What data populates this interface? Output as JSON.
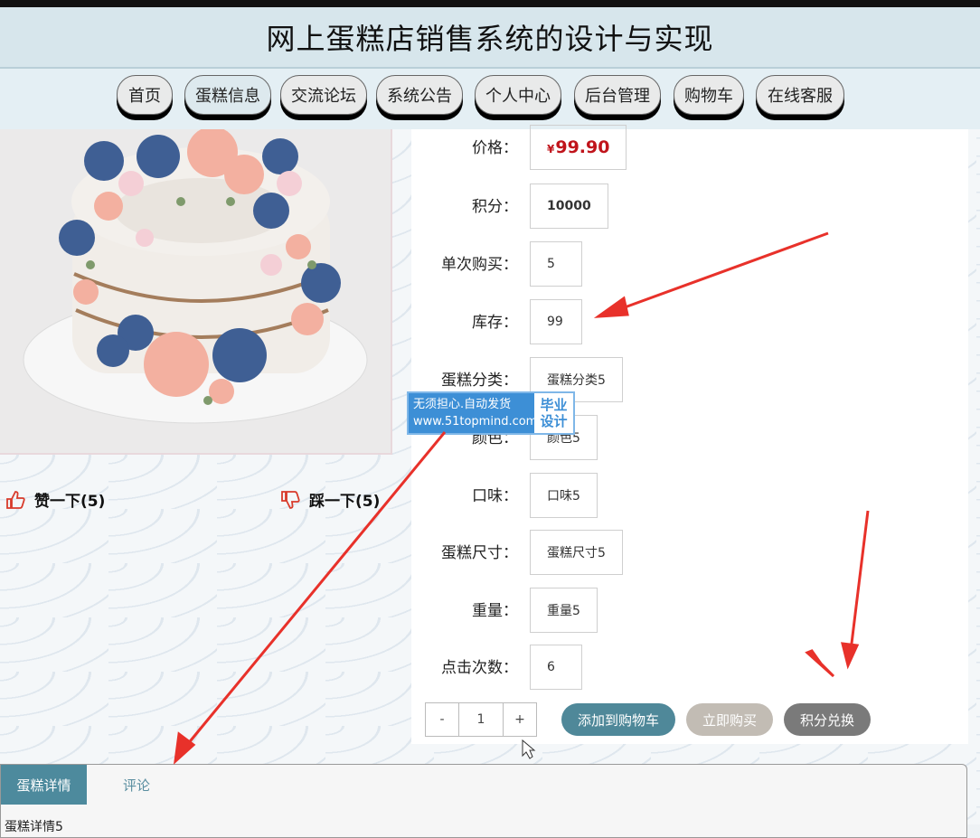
{
  "header": {
    "title": "网上蛋糕店销售系统的设计与实现"
  },
  "nav": {
    "items": [
      "首页",
      "蛋糕信息",
      "交流论坛",
      "系统公告",
      "个人中心",
      "后台管理",
      "购物车",
      "在线客服"
    ]
  },
  "product": {
    "price_currency": "¥",
    "price_value": "99.90",
    "fields": [
      {
        "label": "价格：",
        "value": "99.90"
      },
      {
        "label": "积分：",
        "value": "10000"
      },
      {
        "label": "单次购买：",
        "value": "5"
      },
      {
        "label": "库存：",
        "value": "99"
      },
      {
        "label": "蛋糕分类：",
        "value": "蛋糕分类5"
      },
      {
        "label": "颜色：",
        "value": "颜色5"
      },
      {
        "label": "口味：",
        "value": "口味5"
      },
      {
        "label": "蛋糕尺寸：",
        "value": "蛋糕尺寸5"
      },
      {
        "label": "重量：",
        "value": "重量5"
      },
      {
        "label": "点击次数：",
        "value": "6"
      }
    ]
  },
  "votes": {
    "like": "赞一下(5)",
    "dislike": "踩一下(5)"
  },
  "quantity": {
    "minus": "-",
    "value": "1",
    "plus": "+"
  },
  "actions": {
    "add_cart": "添加到购物车",
    "buy_now": "立即购买",
    "exchange": "积分兑换"
  },
  "colors": {
    "add_cart": "#4f8899",
    "buy_now": "#c2bcb4",
    "exchange": "#7a7a7a",
    "price": "#c0141b",
    "tab_active": "#4d8a9d"
  },
  "tabs": {
    "detail": "蛋糕详情",
    "comment": "评论",
    "content": "蛋糕详情5"
  },
  "watermark": {
    "line1": "无须担心.自动发货",
    "line2": "www.51topmind.com",
    "right1": "毕业",
    "right2": "设计"
  }
}
